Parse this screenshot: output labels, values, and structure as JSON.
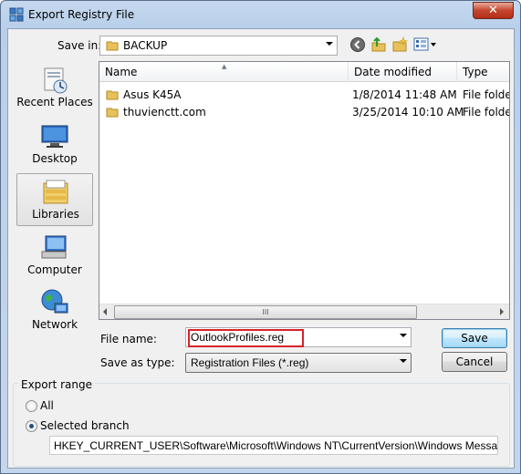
{
  "window": {
    "title": "Export Registry File",
    "close_symbol": "✕"
  },
  "toolbar": {
    "save_in_label": "Save in:",
    "save_in_value": "BACKUP",
    "icons": [
      "back-icon",
      "up-folder-icon",
      "new-folder-icon",
      "view-menu-icon"
    ]
  },
  "places": [
    {
      "label": "Recent Places",
      "icon": "recent-places-icon"
    },
    {
      "label": "Desktop",
      "icon": "desktop-icon"
    },
    {
      "label": "Libraries",
      "icon": "libraries-icon",
      "selected": true
    },
    {
      "label": "Computer",
      "icon": "computer-icon"
    },
    {
      "label": "Network",
      "icon": "network-icon"
    }
  ],
  "filelist": {
    "columns": [
      "Name",
      "Date modified",
      "Type"
    ],
    "rows": [
      {
        "name": "Asus K45A",
        "date": "1/8/2014 11:48 AM",
        "type": "File folder"
      },
      {
        "name": "thuvienctt.com",
        "date": "3/25/2014 10:10 AM",
        "type": "File folder"
      }
    ],
    "scroll_grip": "III"
  },
  "form": {
    "file_name_label": "File name:",
    "file_name_value": "OutlookProfiles.reg",
    "save_type_label": "Save as type:",
    "save_type_value": "Registration Files (*.reg)",
    "save_button": "Save",
    "cancel_button": "Cancel"
  },
  "export_range": {
    "legend": "Export range",
    "all_label": "All",
    "selected_label": "Selected branch",
    "selected_option": "Selected branch",
    "branch_path": "HKEY_CURRENT_USER\\Software\\Microsoft\\Windows NT\\CurrentVersion\\Windows Messaging Subsystem\\Profiles"
  },
  "colors": {
    "highlight_border": "#d8232a",
    "title_bar": "#c5d8ef",
    "folder": "#e8c15a"
  }
}
